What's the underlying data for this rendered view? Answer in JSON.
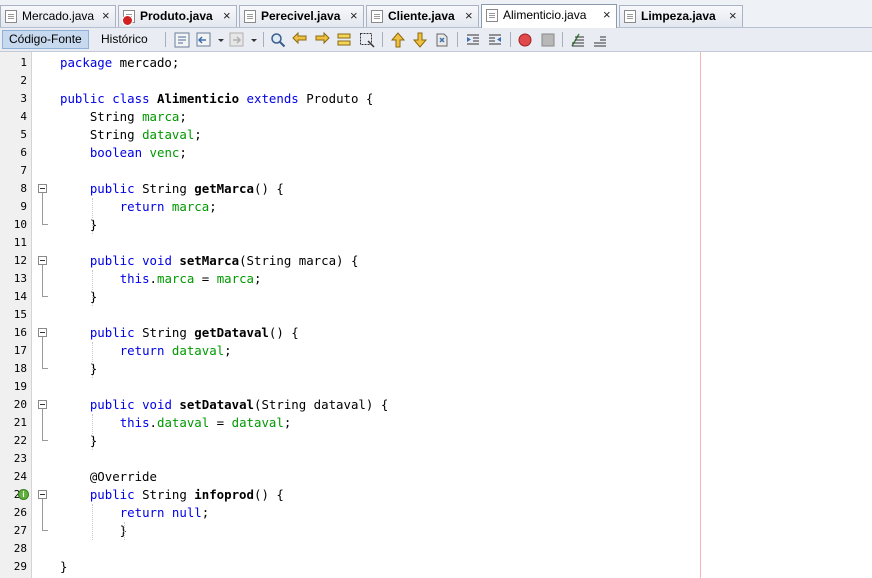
{
  "tabs": [
    {
      "label": "Mercado.java",
      "bold": false,
      "error": false,
      "active": false
    },
    {
      "label": "Produto.java",
      "bold": true,
      "error": true,
      "active": false
    },
    {
      "label": "Perecivel.java",
      "bold": true,
      "error": false,
      "active": false
    },
    {
      "label": "Cliente.java",
      "bold": true,
      "error": false,
      "active": false
    },
    {
      "label": "Alimenticio.java",
      "bold": false,
      "error": false,
      "active": true
    },
    {
      "label": "Limpeza.java",
      "bold": true,
      "error": false,
      "active": false
    }
  ],
  "tab_close_glyph": "×",
  "toolbar": {
    "source_label": "Código-Fonte",
    "history_label": "Histórico"
  },
  "editor": {
    "line_numbers": [
      "1",
      "2",
      "3",
      "4",
      "5",
      "6",
      "7",
      "8",
      "9",
      "10",
      "11",
      "12",
      "13",
      "14",
      "15",
      "16",
      "17",
      "18",
      "19",
      "20",
      "21",
      "22",
      "23",
      "24",
      "25",
      "26",
      "27",
      "28",
      "29"
    ],
    "lines": [
      "package mercado;",
      "",
      "public class Alimenticio extends Produto {",
      "    String marca;",
      "    String dataval;",
      "    boolean venc;",
      "",
      "    public String getMarca() {",
      "        return marca;",
      "    }",
      "",
      "    public void setMarca(String marca) {",
      "        this.marca = marca;",
      "    }",
      "",
      "    public String getDataval() {",
      "        return dataval;",
      "    }",
      "",
      "    public void setDataval(String dataval) {",
      "        this.dataval = dataval;",
      "    }",
      "",
      "    @Override",
      "    public String infoprod() {",
      "        return null;",
      "        }",
      "",
      "}"
    ],
    "override_marker": "i"
  },
  "colors": {
    "keyword": "#0000e6",
    "field": "#009900",
    "gutter_bg": "#f0f0f0",
    "right_margin": "#f3b4b4",
    "override_marker": "#5fb13c"
  }
}
